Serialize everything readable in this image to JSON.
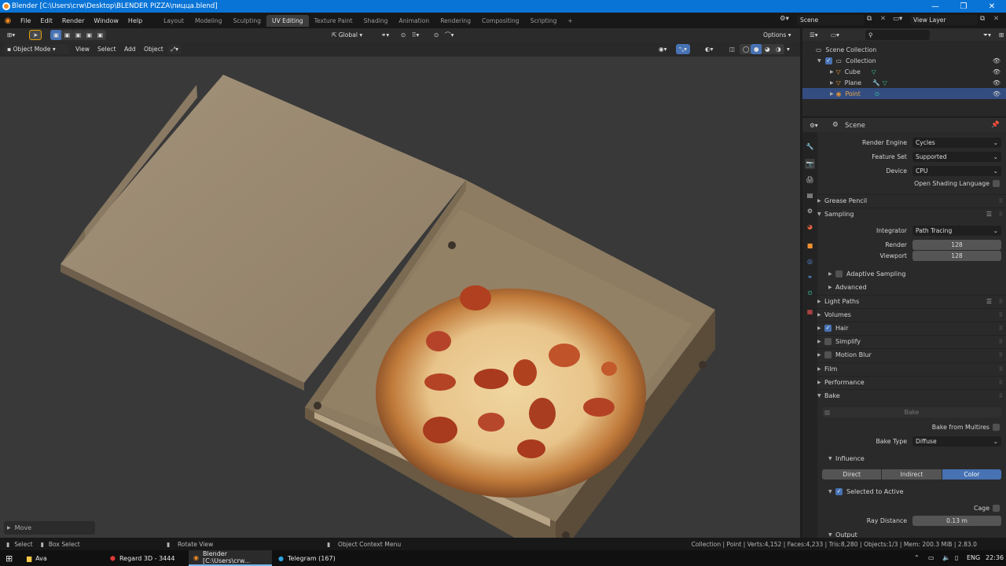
{
  "window": {
    "title": "Blender [C:\\Users\\crw\\Desktop\\BLENDER PIZZA\\пицца.blend]",
    "min": "—",
    "max": "❐",
    "close": "✕"
  },
  "menu": [
    "File",
    "Edit",
    "Render",
    "Window",
    "Help"
  ],
  "workspaces": [
    "Layout",
    "Modeling",
    "Sculpting",
    "UV Editing",
    "Texture Paint",
    "Shading",
    "Animation",
    "Rendering",
    "Compositing",
    "Scripting"
  ],
  "active_workspace": "UV Editing",
  "add_tab": "+",
  "scene_field": "Scene",
  "view_layer_field": "View Layer",
  "viewport": {
    "transform_orientation": "Global",
    "options": "Options",
    "mode": "Object Mode",
    "menus": [
      "View",
      "Select",
      "Add",
      "Object"
    ],
    "last_op": "Move"
  },
  "outliner": {
    "search_placeholder": "",
    "scene_collection": "Scene Collection",
    "collection": "Collection",
    "items": [
      {
        "name": "Cube",
        "selected": false
      },
      {
        "name": "Plane",
        "selected": false
      },
      {
        "name": "Point",
        "selected": true
      }
    ]
  },
  "properties": {
    "context": "Scene",
    "render_engine_label": "Render Engine",
    "render_engine": "Cycles",
    "feature_set_label": "Feature Set",
    "feature_set": "Supported",
    "device_label": "Device",
    "device": "CPU",
    "osl_label": "Open Shading Language",
    "grease_pencil": "Grease Pencil",
    "sampling": "Sampling",
    "integrator_label": "Integrator",
    "integrator": "Path Tracing",
    "render_label": "Render",
    "render_samples": "128",
    "viewport_label": "Viewport",
    "viewport_samples": "128",
    "adaptive_sampling": "Adaptive Sampling",
    "advanced": "Advanced",
    "light_paths": "Light Paths",
    "volumes": "Volumes",
    "hair": "Hair",
    "simplify": "Simplify",
    "motion_blur": "Motion Blur",
    "film": "Film",
    "performance": "Performance",
    "bake": "Bake",
    "bake_button": "Bake",
    "bake_from_multires": "Bake from Multires",
    "bake_type_label": "Bake Type",
    "bake_type": "Diffuse",
    "influence": "Influence",
    "influence_buttons": [
      "Direct",
      "Indirect",
      "Color"
    ],
    "selected_to_active": "Selected to Active",
    "cage": "Cage",
    "ray_distance_label": "Ray Distance",
    "ray_distance": "0.13 m",
    "output": "Output"
  },
  "status": {
    "select": "Select",
    "box_select": "Box Select",
    "rotate_view": "Rotate View",
    "context_menu": "Object Context Menu",
    "stats": "Collection | Point | Verts:4,152 | Faces:4,233 | Tris:8,280 | Objects:1/3 | Mem: 200.3 MiB | 2.83.0"
  },
  "taskbar": {
    "items": [
      "Ava",
      "Regard 3D - 3444",
      "Blender [C:\\Users\\crw...",
      "Telegram (167)"
    ],
    "lang": "ENG",
    "time": "22:36"
  },
  "colors": {
    "accent": "#4772b3",
    "title_blue": "#0a74d6",
    "blender_orange": "#f08a24"
  }
}
